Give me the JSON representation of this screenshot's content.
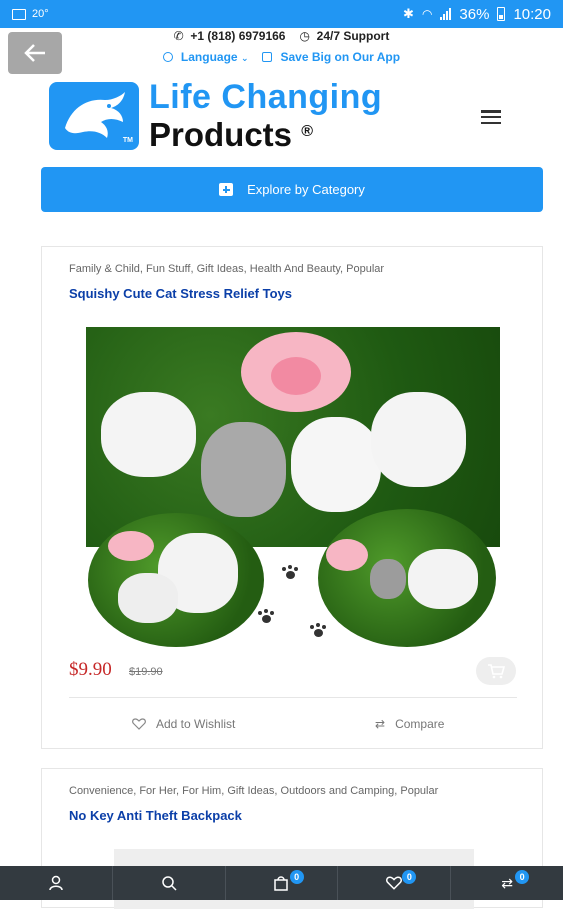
{
  "status_bar": {
    "temperature": "20°",
    "battery": "36%",
    "time": "10:20"
  },
  "header": {
    "phone": "+1 (818) 6979166",
    "support": "24/7 Support",
    "language": "Language",
    "app_promo": "Save Big on Our App",
    "logo_line1": "Life Changing",
    "logo_line2": "Products",
    "logo_reg": "®",
    "logo_tm": "TM"
  },
  "explore_button": "Explore by Category",
  "products": [
    {
      "categories": "Family & Child, Fun Stuff, Gift Ideas, Health And Beauty, Popular",
      "title": "Squishy Cute Cat Stress Relief Toys",
      "price": "$9.90",
      "old_price": "$19.90",
      "wishlist": "Add to Wishlist",
      "compare": "Compare"
    },
    {
      "categories": "Convenience, For Her, For Him, Gift Ideas, Outdoors and Camping, Popular",
      "title": "No Key Anti Theft Backpack"
    }
  ],
  "bottom_nav": {
    "cart_count": "0",
    "wishlist_count": "0",
    "compare_count": "0"
  },
  "colors": {
    "accent": "#2196f3",
    "price": "#c62828",
    "title": "#0b3fa8",
    "nav_bg": "#333a40"
  }
}
